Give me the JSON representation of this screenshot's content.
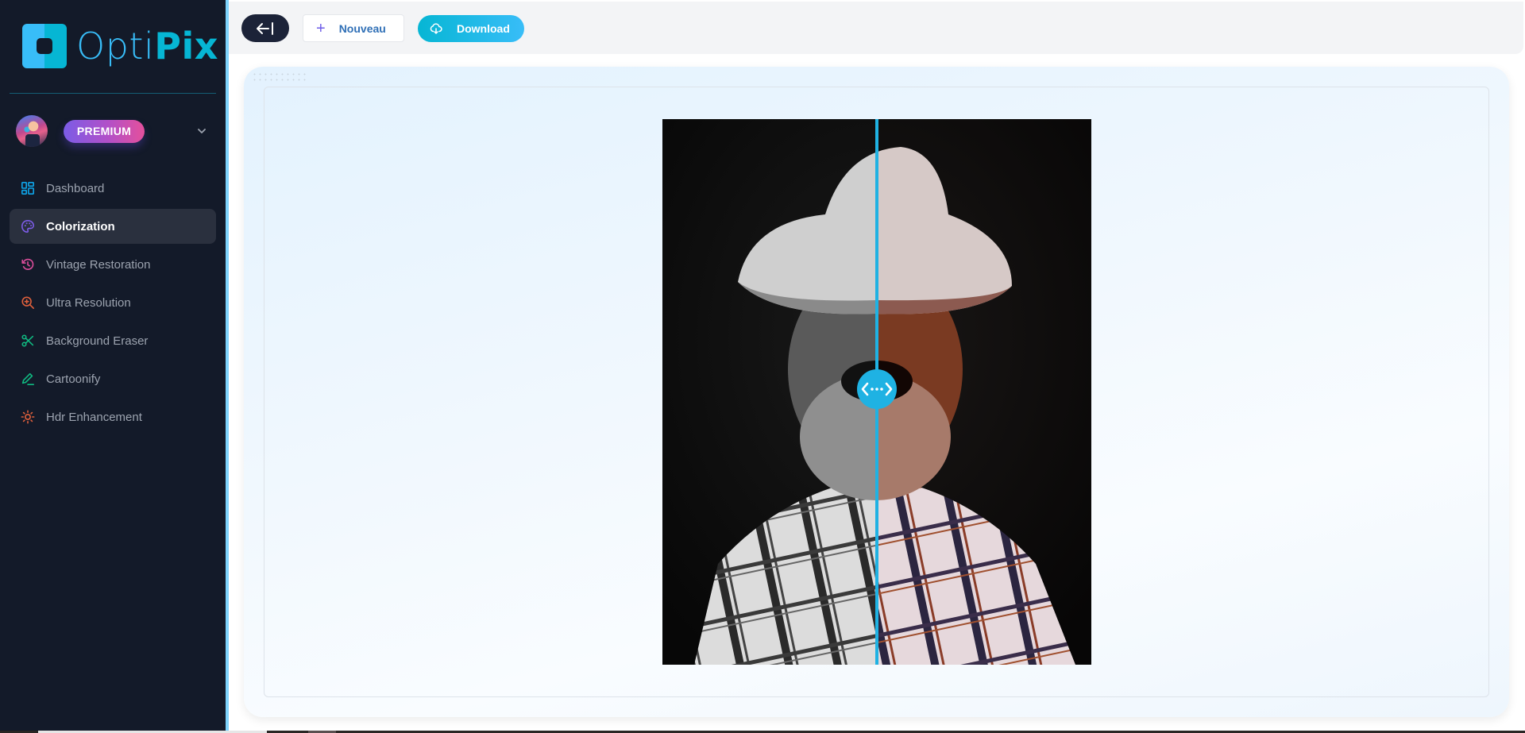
{
  "app": {
    "name_part1": "Opti",
    "name_part2": "Pix"
  },
  "user": {
    "plan_badge": "PREMIUM"
  },
  "sidebar": {
    "items": [
      {
        "label": "Dashboard",
        "icon": "dashboard-grid-icon",
        "color": "#0ea5e9",
        "active": false
      },
      {
        "label": "Colorization",
        "icon": "palette-icon",
        "color": "#7c5ce6",
        "active": true
      },
      {
        "label": "Vintage Restoration",
        "icon": "history-icon",
        "color": "#db4d9a",
        "active": false
      },
      {
        "label": "Ultra Resolution",
        "icon": "zoom-in-icon",
        "color": "#e0603c",
        "active": false
      },
      {
        "label": "Background Eraser",
        "icon": "scissors-icon",
        "color": "#10b981",
        "active": false
      },
      {
        "label": "Cartoonify",
        "icon": "pen-icon",
        "color": "#10b981",
        "active": false
      },
      {
        "label": "Hdr Enhancement",
        "icon": "sun-icon",
        "color": "#e0603c",
        "active": false
      }
    ]
  },
  "toolbar": {
    "new_label": "Nouveau",
    "download_label": "Download"
  },
  "comparison": {
    "left_label": "original-grayscale",
    "right_label": "colorized",
    "split_percent": 50,
    "accent": "#1fb2e3"
  }
}
